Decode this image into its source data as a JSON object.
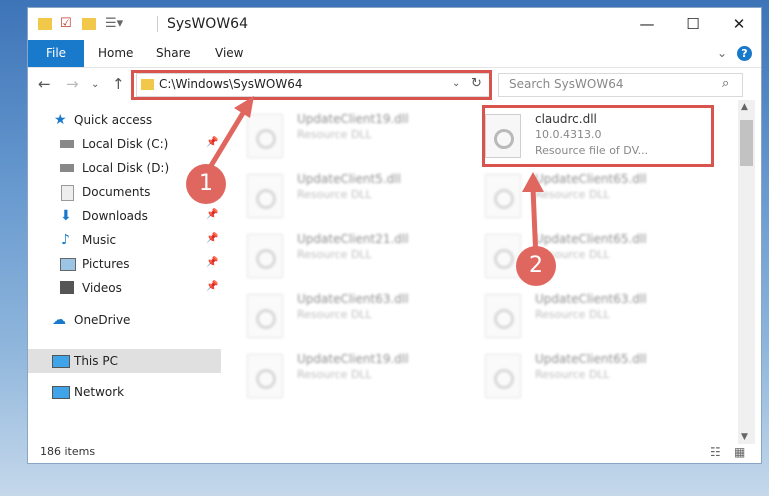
{
  "window": {
    "title": "SysWOW64"
  },
  "window_controls": {
    "minimize": "—",
    "maximize": "☐",
    "close": "✕"
  },
  "ribbon": {
    "file": "File",
    "home": "Home",
    "share": "Share",
    "view": "View",
    "help": "?"
  },
  "address": {
    "path": "C:\\Windows\\SysWOW64"
  },
  "search": {
    "placeholder": "Search SysWOW64"
  },
  "sidebar": {
    "items": [
      {
        "label": "Quick access"
      },
      {
        "label": "Local Disk (C:)"
      },
      {
        "label": "Local Disk (D:)"
      },
      {
        "label": "Documents"
      },
      {
        "label": "Downloads"
      },
      {
        "label": "Music"
      },
      {
        "label": "Pictures"
      },
      {
        "label": "Videos"
      },
      {
        "label": "OneDrive"
      },
      {
        "label": "This PC"
      },
      {
        "label": "Network"
      }
    ]
  },
  "files": [
    {
      "name": "UpdateClient19.dll",
      "sub": "Resource DLL"
    },
    {
      "name": "claudrc.dll",
      "sub": "10.0.4313.0",
      "type": "Resource file of DV..."
    },
    {
      "name": "UpdateClient5.dll",
      "sub": "Resource DLL"
    },
    {
      "name": "UpdateClient65.dll",
      "sub": "Resource DLL"
    },
    {
      "name": "UpdateClient21.dll",
      "sub": "Resource DLL"
    },
    {
      "name": "UpdateClient65.dll",
      "sub": "Resource DLL"
    },
    {
      "name": "UpdateClient63.dll",
      "sub": "Resource DLL"
    },
    {
      "name": "UpdateClient63.dll",
      "sub": "Resource DLL"
    },
    {
      "name": "UpdateClient19.dll",
      "sub": "Resource DLL"
    },
    {
      "name": "UpdateClient65.dll",
      "sub": "Resource DLL"
    }
  ],
  "status": {
    "count": "186 items"
  },
  "annotations": {
    "step1": "1",
    "step2": "2"
  },
  "colors": {
    "accent": "#1979ca",
    "highlight": "#d9534f",
    "callout": "#e06660"
  }
}
